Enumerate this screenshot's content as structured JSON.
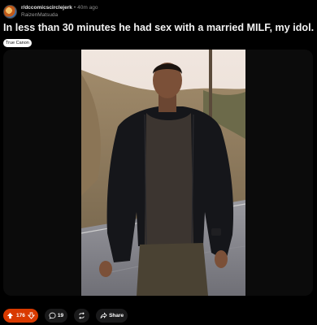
{
  "post": {
    "subreddit": "r/dccomicscirclejerk",
    "separator": "•",
    "time": "40m ago",
    "author": "RaizenMatsuda",
    "title": "In less than 30 minutes he had sex with a married MILF, my idol.",
    "flair": "True Canon"
  },
  "actions": {
    "score": "176",
    "comments": "19",
    "share_label": "Share"
  },
  "colors": {
    "background": "#000000",
    "vote_accent": "#d93a00",
    "pill": "#1a1a1b"
  },
  "icons": [
    "upvote-icon",
    "downvote-icon",
    "comment-icon",
    "crosspost-icon",
    "share-icon"
  ]
}
